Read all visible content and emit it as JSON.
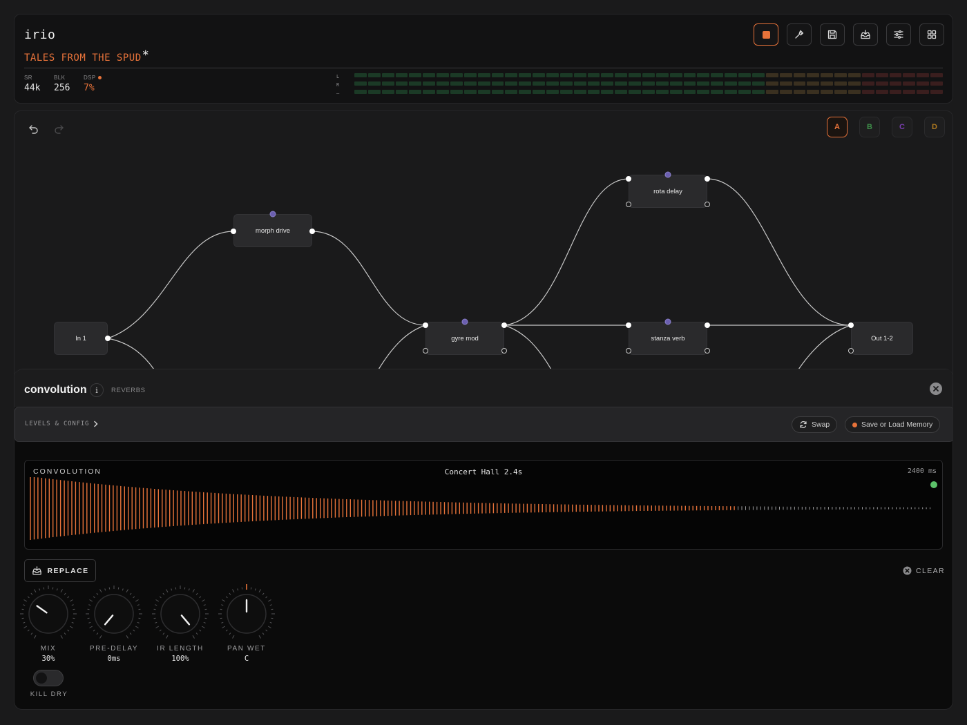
{
  "app": {
    "title": "irio",
    "project_name": "TALES FROM THE SPUD",
    "unsaved_marker": "*"
  },
  "stats": [
    {
      "label": "SR",
      "value": "44k"
    },
    {
      "label": "BLK",
      "value": "256"
    },
    {
      "label": "DSP",
      "value": "7%"
    }
  ],
  "meter": {
    "labels": [
      "L",
      "R",
      "—"
    ],
    "levels": [
      0,
      0,
      0
    ]
  },
  "toolbar": [
    {
      "name": "stop-button",
      "icon": "stop-icon",
      "active": true
    },
    {
      "name": "tools-button",
      "icon": "wrench-icon",
      "active": false
    },
    {
      "name": "save-button",
      "icon": "floppy-disk-icon",
      "active": false
    },
    {
      "name": "import-button",
      "icon": "tray-import-icon",
      "active": false
    },
    {
      "name": "settings-button",
      "icon": "sliders-icon",
      "active": false
    },
    {
      "name": "grid-view-button",
      "icon": "grid-icon",
      "active": false
    }
  ],
  "scenes": [
    {
      "label": "A",
      "color": "#e8733a",
      "active": true
    },
    {
      "label": "B",
      "color": "#3f8f4a",
      "active": false
    },
    {
      "label": "C",
      "color": "#7a3fb0",
      "active": false
    },
    {
      "label": "D",
      "color": "#b07a20",
      "active": false
    }
  ],
  "graph": {
    "nodes": [
      {
        "id": "in1",
        "label": "In 1"
      },
      {
        "id": "morph",
        "label": "morph drive"
      },
      {
        "id": "gyre",
        "label": "gyre mod"
      },
      {
        "id": "rota",
        "label": "rota delay"
      },
      {
        "id": "stanza",
        "label": "stanza verb"
      },
      {
        "id": "out12",
        "label": "Out 1-2"
      }
    ]
  },
  "plugin": {
    "name": "convolution",
    "info_symbol": "i",
    "category": "REVERBS",
    "levels_link": "LEVELS & CONFIG",
    "swap_label": "Swap",
    "memory_label": "Save or Load Memory",
    "ir": {
      "label": "CONVOLUTION",
      "name": "Concert Hall 2.4s",
      "length": "2400 ms",
      "status_color": "#5cc26a"
    },
    "replace_label": "REPLACE",
    "clear_label": "CLEAR",
    "knobs": [
      {
        "label": "MIX",
        "value": "30%"
      },
      {
        "label": "PRE-DELAY",
        "value": "0ms"
      },
      {
        "label": "IR LENGTH",
        "value": "100%"
      },
      {
        "label": "PAN WET",
        "value": "C"
      }
    ],
    "kill_dry_label": "KILL DRY",
    "kill_dry_on": false
  },
  "colors": {
    "accent": "#e8733a",
    "ok": "#5cc26a",
    "port": "#6b5fb0"
  }
}
